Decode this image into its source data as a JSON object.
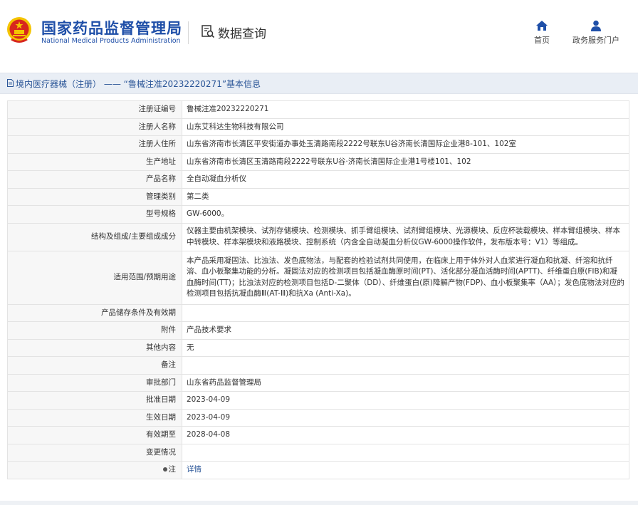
{
  "header": {
    "org_name_cn": "国家药品监督管理局",
    "org_name_en": "National Medical Products Administration",
    "query_label": "数据查询",
    "nav": [
      {
        "label": "首页",
        "icon": "home-icon"
      },
      {
        "label": "政务服务门户",
        "icon": "user-icon"
      }
    ]
  },
  "breadcrumb": {
    "text": "境内医疗器械（注册） —— “鲁械注准20232220271”基本信息"
  },
  "rows": [
    {
      "label": "注册证编号",
      "value": "鲁械注准20232220271"
    },
    {
      "label": "注册人名称",
      "value": "山东艾科达生物科技有限公司"
    },
    {
      "label": "注册人住所",
      "value": "山东省济南市长清区平安街道办事处玉清路南段2222号联东U谷济南长清国际企业港8-101、102室"
    },
    {
      "label": "生产地址",
      "value": "山东省济南市长清区玉清路南段2222号联东U谷·济南长清国际企业港1号楼101、102"
    },
    {
      "label": "产品名称",
      "value": "全自动凝血分析仪"
    },
    {
      "label": "管理类别",
      "value": "第二类"
    },
    {
      "label": "型号规格",
      "value": "GW-6000。"
    },
    {
      "label": "结构及组成/主要组成成分",
      "value": "仪器主要由机架模块、试剂存储模块、检测模块、抓手臂组模块、试剂臂组模块、光源模块、反应杯装载模块、样本臂组模块、样本中转模块、样本架模块和液路模块、控制系统（内含全自动凝血分析仪GW-6000操作软件，发布版本号：V1）等组成。"
    },
    {
      "label": "适用范围/预期用途",
      "value": "本产品采用凝固法、比浊法、发色底物法，与配套的检验试剂共同使用，在临床上用于体外对人血浆进行凝血和抗凝、纤溶和抗纤溶、血小板聚集功能的分析。凝固法对应的检测项目包括凝血酶原时间(PT)、活化部分凝血活酶时间(APTT)、纤维蛋白原(FIB)和凝血酶时间(TT)；比浊法对应的检测项目包括D-二聚体（DD）、纤维蛋白(原)降解产物(FDP)、血小板聚集率（AA）；发色底物法对应的检测项目包括抗凝血酶Ⅲ(AT-Ⅲ)和抗Xa (Anti-Xa)。"
    },
    {
      "label": "产品储存条件及有效期",
      "value": ""
    },
    {
      "label": "附件",
      "value": "产品技术要求"
    },
    {
      "label": "其他内容",
      "value": "无"
    },
    {
      "label": "备注",
      "value": ""
    },
    {
      "label": "审批部门",
      "value": "山东省药品监督管理局"
    },
    {
      "label": "批准日期",
      "value": "2023-04-09"
    },
    {
      "label": "生效日期",
      "value": "2023-04-09"
    },
    {
      "label": "有效期至",
      "value": "2028-04-08"
    },
    {
      "label": "变更情况",
      "value": ""
    },
    {
      "label": "注",
      "value": "详情"
    }
  ],
  "colors": {
    "brand_blue": "#1f4fa8",
    "link_blue": "#2a5597",
    "emblem_red": "#d7261d",
    "emblem_gold": "#f4c400"
  }
}
